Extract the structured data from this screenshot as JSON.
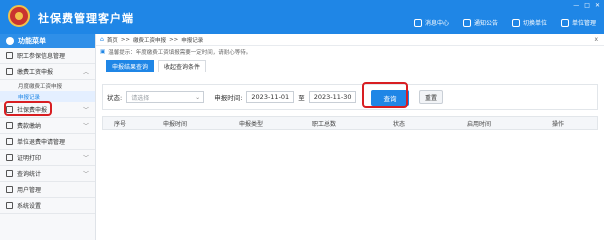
{
  "header": {
    "app_title": "社保费管理客户端",
    "nav": [
      {
        "label": "消息中心",
        "icon": "bell-icon"
      },
      {
        "label": "通知公告",
        "icon": "notice-icon"
      },
      {
        "label": "切换单位",
        "icon": "switch-icon"
      },
      {
        "label": "单位管理",
        "icon": "org-icon"
      }
    ],
    "window_controls": [
      "—",
      "□",
      "✕"
    ]
  },
  "sidebar": {
    "header": "功能菜单",
    "items": [
      {
        "label": "职工参保信息管理",
        "icon": "person-card-icon",
        "has_chevron": false
      },
      {
        "label": "缴费工资申报",
        "icon": "form-icon",
        "has_chevron": true,
        "expanded": true,
        "children": [
          {
            "label": "月度缴费工资申报",
            "active": false
          },
          {
            "label": "申报记录",
            "active": true
          }
        ]
      },
      {
        "label": "社保费申报",
        "icon": "declare-icon",
        "has_chevron": true
      },
      {
        "label": "费款缴纳",
        "icon": "payment-icon",
        "has_chevron": true
      },
      {
        "label": "单位退费申请管理",
        "icon": "refund-icon",
        "has_chevron": false
      },
      {
        "label": "证明打印",
        "icon": "print-icon",
        "has_chevron": true
      },
      {
        "label": "查询统计",
        "icon": "stats-icon",
        "has_chevron": true
      },
      {
        "label": "用户管理",
        "icon": "user-icon",
        "has_chevron": false
      },
      {
        "label": "系统设置",
        "icon": "gear-icon",
        "has_chevron": false
      }
    ]
  },
  "breadcrumb": {
    "home": "首页",
    "sep": ">>",
    "parent": "缴费工资申报",
    "current": "申报记录",
    "close": "x"
  },
  "tip": "温馨提示：年度缴费工资填报需要一定时间，请耐心等待。",
  "tabs": [
    {
      "label": "申报结果查询",
      "active": true
    },
    {
      "label": "收起查询条件",
      "active": false
    }
  ],
  "filter": {
    "status_label": "状态:",
    "status_placeholder": "请选择",
    "date_label": "申报时间:",
    "date_from": "2023-11-01",
    "date_sep": "至",
    "date_to": "2023-11-30",
    "query_button": "查询",
    "reset_button": "重置"
  },
  "table": {
    "columns": [
      "序号",
      "申报时间",
      "申报类型",
      "职工总数",
      "状态",
      "启用时间",
      "操作"
    ]
  },
  "colors": {
    "primary": "#1f86e6",
    "highlight": "#d81e22"
  }
}
